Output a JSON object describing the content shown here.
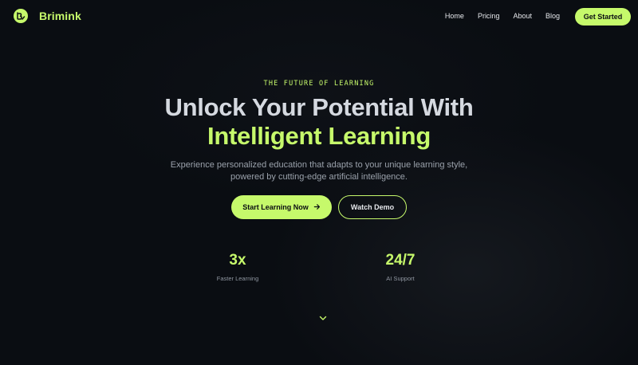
{
  "nav": {
    "brand": "Brimink",
    "logo_icon": "brand-logo-icon",
    "links": [
      "Home",
      "Pricing",
      "About",
      "Blog"
    ],
    "cta": "Get Started"
  },
  "hero": {
    "eyebrow": "THE FUTURE OF LEARNING",
    "headline_line1": "Unlock Your Potential With",
    "headline_line2": "Intelligent Learning",
    "subtext_line1": "Experience personalized education that adapts to your unique learning style,",
    "subtext_line2": "powered by cutting-edge artificial intelligence.",
    "primary_cta": "Start Learning Now",
    "primary_cta_icon": "arrow-right-icon",
    "secondary_cta": "Watch Demo"
  },
  "stats": [
    {
      "value": "3x",
      "label": "Faster Learning"
    },
    {
      "value": "24/7",
      "label": "AI Support"
    }
  ],
  "scroll_icon": "chevron-down-icon",
  "colors": {
    "accent": "#c6f96b",
    "background": "#0a0d12",
    "headline": "#d5d9e0",
    "muted": "#9aa1ab"
  }
}
